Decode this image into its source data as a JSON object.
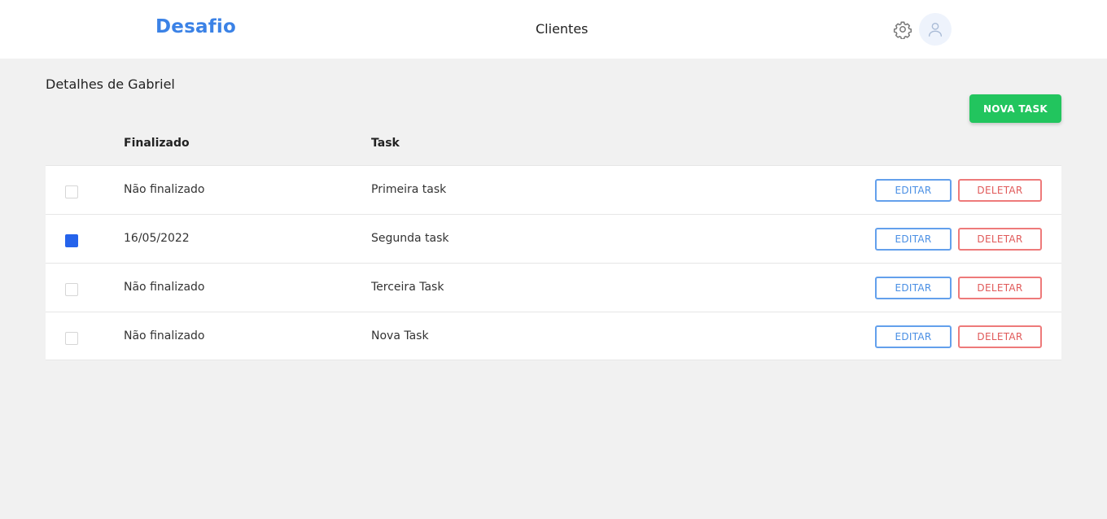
{
  "header": {
    "brand": "Desafio",
    "nav_link": "Clientes",
    "settings_icon": "gear-icon",
    "avatar_icon": "user-icon"
  },
  "page": {
    "title": "Detalhes de Gabriel",
    "new_task_label": "NOVA TASK"
  },
  "table": {
    "columns": {
      "done": "Finalizado",
      "task": "Task"
    },
    "edit_label": "EDITAR",
    "delete_label": "DELETAR",
    "rows": [
      {
        "checked": false,
        "done": "Não finalizado",
        "task": "Primeira task"
      },
      {
        "checked": true,
        "done": "16/05/2022",
        "task": "Segunda task"
      },
      {
        "checked": false,
        "done": "Não finalizado",
        "task": "Terceira Task"
      },
      {
        "checked": false,
        "done": "Não finalizado",
        "task": "Nova Task"
      }
    ]
  },
  "colors": {
    "brand": "#3b82e6",
    "primary_green": "#22c55e",
    "checkbox_checked": "#2563eb",
    "edit_outline": "#63a0ec",
    "delete_outline": "#ee7a7a",
    "page_bg": "#f1f1f1"
  }
}
